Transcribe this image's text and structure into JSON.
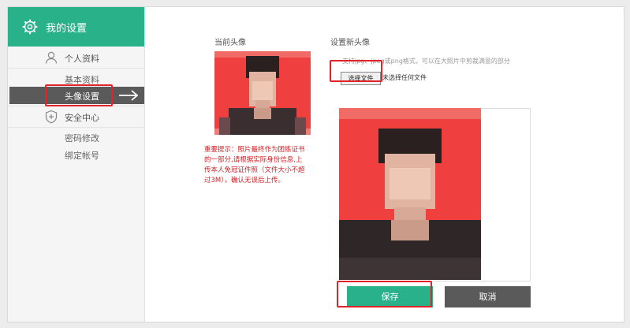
{
  "sidebar": {
    "title": "我的设置",
    "sections": [
      {
        "label": "个人资料",
        "icon": "person-icon"
      },
      {
        "label": "安全中心",
        "icon": "shield-icon"
      }
    ],
    "items": [
      "基本资料",
      "头像设置",
      "密码修改",
      "绑定帐号"
    ],
    "active_item": "头像设置"
  },
  "current": {
    "title": "当前头像",
    "warning": "重要提示：照片最终作为团练证书的一部分,请根据实际身份信息,上传本人免冠证件照（文件大小不超过3M），确认无误后上传。"
  },
  "upload": {
    "title": "设置新头像",
    "hint": "支持jpg、jpeg或png格式，可以在大照片中剪裁满意的部分",
    "file_button": "选择文件",
    "file_status": "未选择任何文件"
  },
  "actions": {
    "save": "保存",
    "cancel": "取消"
  },
  "colors": {
    "accent": "#29b28a",
    "highlight": "#e0242a",
    "dark": "#5a5a5a",
    "photo_bg": "#ef3f3f"
  }
}
